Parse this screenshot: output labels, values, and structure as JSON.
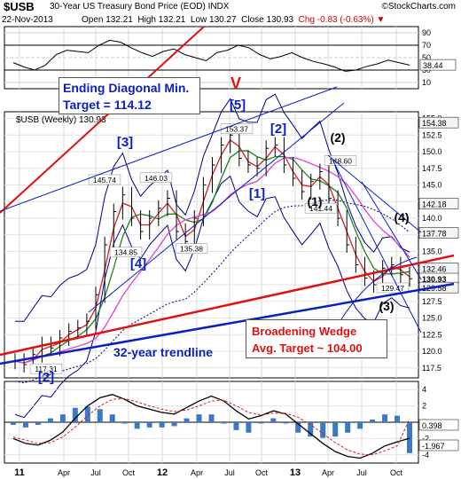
{
  "header": {
    "ticker": "$USB",
    "title": "30-Year US Treasury Bond Price (EOD) INDX",
    "date": "22-Nov-2013",
    "open": "Open 132.21",
    "high": "High 132.21",
    "low": "Low 130.27",
    "close": "Close 130.93",
    "chg": "Chg -0.83 (-0.63%)",
    "brand": "©StockCharts.com"
  },
  "colors": {
    "blue_annotation": "#0a1fbf",
    "red_annotation": "#e01010",
    "price_bar": "#000000",
    "ma_pink": "#e040e0",
    "ma_red": "#d02020",
    "ma_green": "#208020",
    "bollinger": "#000080",
    "macd_hist": "#3a78c8"
  },
  "chart_data": [
    {
      "type": "line",
      "panel": "RSI",
      "ylim": [
        0,
        100
      ],
      "ticks": [
        10,
        30,
        50,
        70,
        90
      ],
      "current_value": 38.44,
      "current_label": "38.44",
      "series": [
        {
          "values": [
            42,
            35,
            30,
            38,
            55,
            62,
            60,
            58,
            70,
            78,
            75,
            66,
            58,
            52,
            60,
            64,
            55,
            50,
            45,
            58,
            62,
            70,
            66,
            55,
            48,
            52,
            58,
            50,
            44,
            40,
            35,
            28,
            30,
            36,
            40,
            46,
            42,
            38
          ]
        }
      ]
    },
    {
      "type": "bar",
      "panel": "price",
      "legend_label": "$USB (Weekly) 130.93",
      "ylim": [
        116,
        156
      ],
      "y_ticks": [
        117.5,
        120.0,
        122.5,
        125.0,
        127.5,
        130.0,
        132.5,
        135.0,
        137.5,
        140.0,
        142.5,
        145.0,
        147.5,
        150.0,
        152.5,
        155.0
      ],
      "y_tick_labels": [
        "117.5",
        "120.0",
        "122.5",
        "125.0",
        "127.5",
        "130.0",
        "132.5",
        "135.0",
        "137.5",
        "140.0",
        "142.5",
        "145.0",
        "147.5",
        "150.0",
        "152.5",
        "155.0"
      ],
      "x_tick_labels": [
        "11",
        "Apr",
        "Jul",
        "Oct",
        "12",
        "Apr",
        "Jul",
        "Oct",
        "13",
        "Apr",
        "Jul",
        "Oct"
      ],
      "close": [
        118.5,
        118.0,
        119.5,
        121.0,
        120.5,
        122.0,
        123.0,
        123.5,
        124.5,
        128.5,
        136.0,
        141.0,
        143.5,
        140.0,
        138.0,
        140.0,
        141.5,
        143.0,
        138.0,
        136.5,
        140.0,
        145.0,
        148.0,
        151.0,
        152.5,
        149.0,
        148.0,
        147.5,
        150.5,
        151.0,
        148.0,
        146.0,
        144.0,
        145.5,
        147.0,
        143.0,
        140.0,
        136.0,
        133.0,
        131.0,
        130.0,
        132.5,
        133.0,
        131.5,
        130.9
      ],
      "price_labels": [
        {
          "text": "117.31",
          "value": 117.31
        },
        {
          "text": "145.74",
          "value": 145.74
        },
        {
          "text": "146.03",
          "value": 146.03
        },
        {
          "text": "134.85",
          "value": 134.85
        },
        {
          "text": "135.38",
          "value": 135.38
        },
        {
          "text": "153.37",
          "value": 153.37
        },
        {
          "text": "148.60",
          "value": 148.6
        },
        {
          "text": "141.44",
          "value": 141.44
        },
        {
          "text": "129.47",
          "value": 129.47
        }
      ],
      "right_markers": [
        {
          "text": "154.38",
          "value": 154.38
        },
        {
          "text": "142.18",
          "value": 142.18
        },
        {
          "text": "137.78",
          "value": 137.78
        },
        {
          "text": "132.46",
          "value": 132.46
        },
        {
          "text": "130.93",
          "value": 130.93
        },
        {
          "text": "129.58",
          "value": 129.58
        }
      ],
      "wave_labels": [
        "[2]",
        "[3]",
        "[4]",
        "[5]",
        "[2]",
        "[1]",
        "V",
        "(1)",
        "(2)",
        "(3)",
        "(4)"
      ],
      "annotations": {
        "ending_diagonal": [
          "Ending Diagonal Min.",
          "Target = 114.12"
        ],
        "broadening_wedge": [
          "Broadening Wedge",
          "Avg. Target ~ 104.00"
        ],
        "trendline": "32-year trendline"
      }
    },
    {
      "type": "line",
      "panel": "MACD",
      "ticks": [
        4,
        2,
        0,
        -2,
        -4
      ],
      "tick_labels": [
        "4",
        "2",
        "0",
        "-2",
        "-4"
      ],
      "current_signal_label": "0.398",
      "current_macd_label": "-1.967",
      "series": [
        {
          "values": [
            -2.0,
            -2.6,
            -2.8,
            -2.2,
            -1.2,
            0.5,
            2.0,
            3.0,
            3.4,
            2.8,
            2.0,
            1.6,
            1.2,
            1.0,
            1.8,
            2.6,
            3.2,
            2.6,
            1.4,
            0.4,
            0.8,
            1.4,
            1.0,
            -0.2,
            -1.4,
            -2.6,
            -3.6,
            -4.2,
            -4.4,
            -3.8,
            -2.9,
            -2.4,
            -1.967
          ]
        },
        {
          "values": [
            -1.8,
            -2.2,
            -2.6,
            -2.5,
            -1.8,
            -0.6,
            0.8,
            2.0,
            2.8,
            2.9,
            2.5,
            2.0,
            1.6,
            1.3,
            1.5,
            2.0,
            2.6,
            2.7,
            2.0,
            1.2,
            0.9,
            1.1,
            1.1,
            0.6,
            -0.3,
            -1.4,
            -2.5,
            -3.4,
            -3.9,
            -4.0,
            -3.5,
            -2.9,
            0.398
          ]
        }
      ]
    }
  ]
}
